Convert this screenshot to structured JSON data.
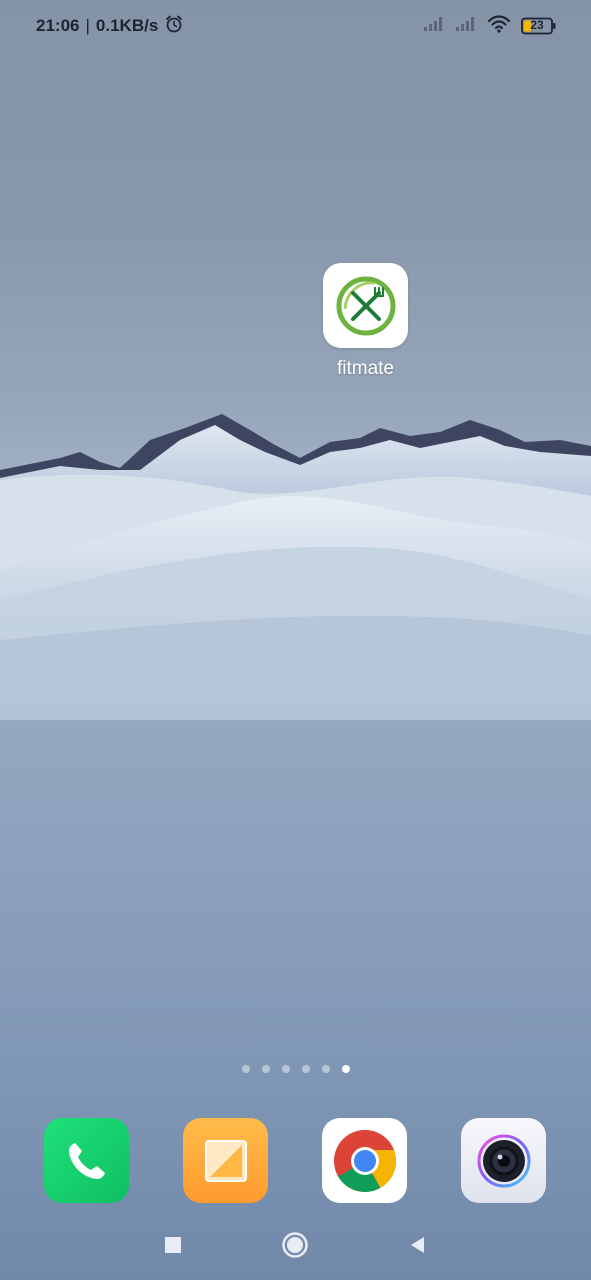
{
  "status_bar": {
    "time": "21:06",
    "separator": "|",
    "net_speed": "0.1KB/s",
    "battery_level": "23",
    "icons": [
      "alarm-icon",
      "signal-icon",
      "signal-icon",
      "wifi-icon",
      "battery-icon"
    ]
  },
  "home": {
    "apps": [
      {
        "label": "fitmate",
        "icon": "fork-knife-icon"
      }
    ],
    "page_count": 6,
    "active_page": 6
  },
  "dock": {
    "apps": [
      {
        "icon": "phone-icon",
        "color": "#14d46e"
      },
      {
        "icon": "notes-icon",
        "color": "#ffa83a"
      },
      {
        "icon": "chrome-icon",
        "color": "#ffffff"
      },
      {
        "icon": "camera-icon",
        "color": "#eef0f5"
      }
    ]
  },
  "nav": {
    "icons": [
      "recents-icon",
      "home-icon",
      "back-icon"
    ]
  }
}
